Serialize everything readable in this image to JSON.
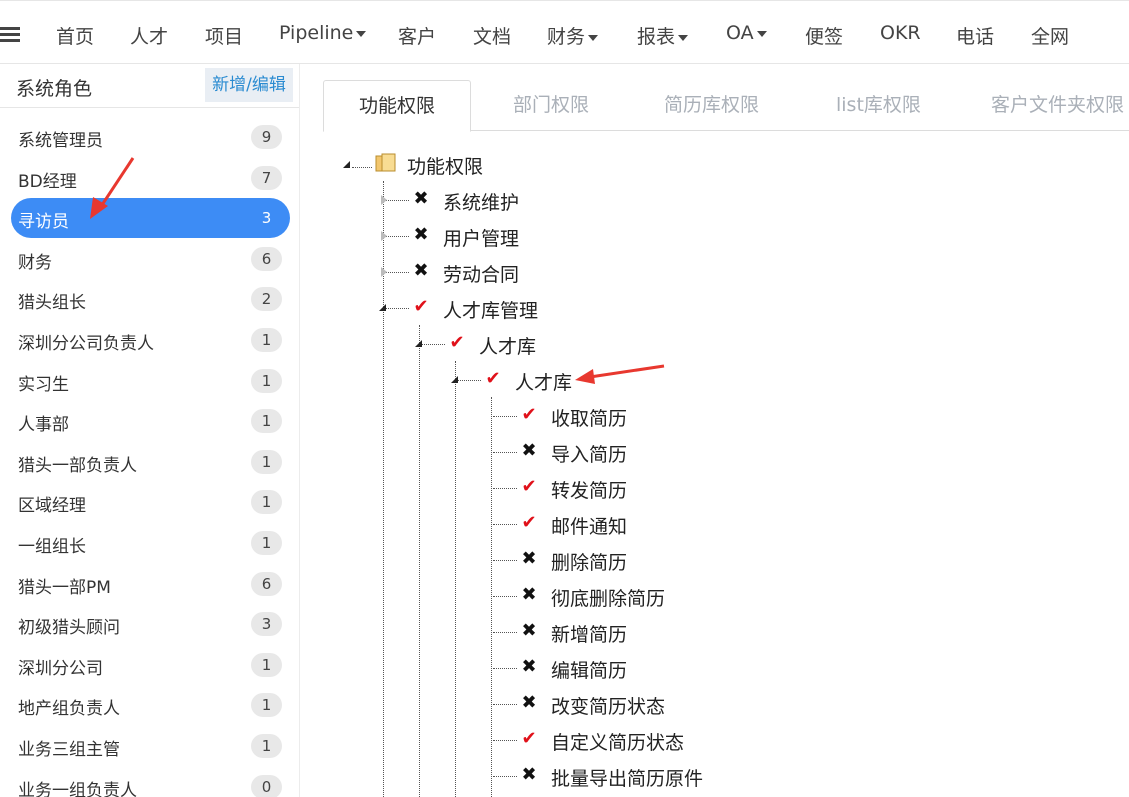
{
  "nav": {
    "items": [
      {
        "label": "首页",
        "dropdown": false
      },
      {
        "label": "人才",
        "dropdown": false
      },
      {
        "label": "项目",
        "dropdown": false
      },
      {
        "label": "Pipeline",
        "dropdown": true
      },
      {
        "label": "客户",
        "dropdown": false
      },
      {
        "label": "文档",
        "dropdown": false
      },
      {
        "label": "财务",
        "dropdown": true
      },
      {
        "label": "报表",
        "dropdown": true
      },
      {
        "label": "OA",
        "dropdown": true
      },
      {
        "label": "便签",
        "dropdown": false
      },
      {
        "label": "OKR",
        "dropdown": false
      },
      {
        "label": "电话",
        "dropdown": false
      },
      {
        "label": "全网",
        "dropdown": false
      }
    ]
  },
  "sidebar": {
    "title": "系统角色",
    "add_edit_label": "新增/编辑",
    "roles": [
      {
        "name": "系统管理员",
        "count": "9",
        "active": false
      },
      {
        "name": "BD经理",
        "count": "7",
        "active": false
      },
      {
        "name": "寻访员",
        "count": "3",
        "active": true
      },
      {
        "name": "财务",
        "count": "6",
        "active": false
      },
      {
        "name": "猎头组长",
        "count": "2",
        "active": false
      },
      {
        "name": "深圳分公司负责人",
        "count": "1",
        "active": false
      },
      {
        "name": "实习生",
        "count": "1",
        "active": false
      },
      {
        "name": "人事部",
        "count": "1",
        "active": false
      },
      {
        "name": "猎头一部负责人",
        "count": "1",
        "active": false
      },
      {
        "name": "区域经理",
        "count": "1",
        "active": false
      },
      {
        "name": "一组组长",
        "count": "1",
        "active": false
      },
      {
        "name": "猎头一部PM",
        "count": "6",
        "active": false
      },
      {
        "name": "初级猎头顾问",
        "count": "3",
        "active": false
      },
      {
        "name": "深圳分公司",
        "count": "1",
        "active": false
      },
      {
        "name": "地产组负责人",
        "count": "1",
        "active": false
      },
      {
        "name": "业务三组主管",
        "count": "1",
        "active": false
      },
      {
        "name": "业务一组负责人",
        "count": "0",
        "active": false
      }
    ]
  },
  "tabs": [
    {
      "label": "功能权限",
      "active": true
    },
    {
      "label": "部门权限",
      "active": false
    },
    {
      "label": "简历库权限",
      "active": false
    },
    {
      "label": "list库权限",
      "active": false
    },
    {
      "label": "客户文件夹权限",
      "active": false
    }
  ],
  "tree": {
    "root": {
      "label": "功能权限",
      "icon": "folder-icon"
    },
    "nodes": [
      {
        "label": "系统维护",
        "checked": false,
        "level": 1,
        "expander": "closed"
      },
      {
        "label": "用户管理",
        "checked": false,
        "level": 1,
        "expander": "closed"
      },
      {
        "label": "劳动合同",
        "checked": false,
        "level": 1,
        "expander": "closed"
      },
      {
        "label": "人才库管理",
        "checked": true,
        "level": 1,
        "expander": "open"
      },
      {
        "label": "人才库",
        "checked": true,
        "level": 2,
        "expander": "open"
      },
      {
        "label": "人才库",
        "checked": true,
        "level": 3,
        "expander": "open"
      },
      {
        "label": "收取简历",
        "checked": true,
        "level": 4,
        "expander": "none"
      },
      {
        "label": "导入简历",
        "checked": false,
        "level": 4,
        "expander": "none"
      },
      {
        "label": "转发简历",
        "checked": true,
        "level": 4,
        "expander": "none"
      },
      {
        "label": "邮件通知",
        "checked": true,
        "level": 4,
        "expander": "none"
      },
      {
        "label": "删除简历",
        "checked": false,
        "level": 4,
        "expander": "none"
      },
      {
        "label": "彻底删除简历",
        "checked": false,
        "level": 4,
        "expander": "none"
      },
      {
        "label": "新增简历",
        "checked": false,
        "level": 4,
        "expander": "none"
      },
      {
        "label": "编辑简历",
        "checked": false,
        "level": 4,
        "expander": "none"
      },
      {
        "label": "改变简历状态",
        "checked": false,
        "level": 4,
        "expander": "none"
      },
      {
        "label": "自定义简历状态",
        "checked": true,
        "level": 4,
        "expander": "none"
      },
      {
        "label": "批量导出简历原件",
        "checked": false,
        "level": 4,
        "expander": "none"
      }
    ]
  },
  "colors": {
    "accent": "#3d8cf5",
    "check": "#e0111a",
    "link": "#2a8bd1",
    "annotation_arrow": "#e8382f"
  }
}
